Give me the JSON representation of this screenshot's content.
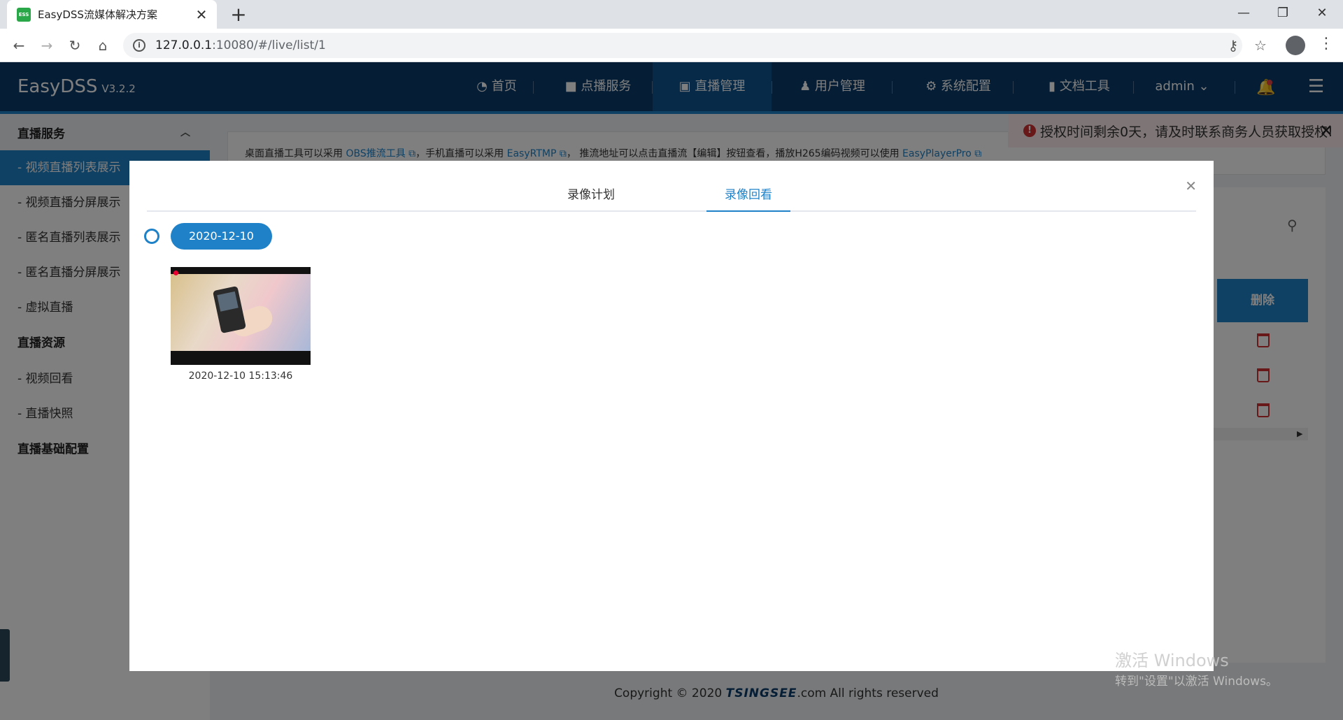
{
  "browser": {
    "tab_title": "EasyDSS流媒体解决方案",
    "favicon_text": "ESS",
    "url_host": "127.0.0.1",
    "url_rest": ":10080/#/live/list/1"
  },
  "app": {
    "brand": "EasyDSS",
    "version": "V3.2.2",
    "nav": [
      {
        "label": "首页",
        "icon": "dashboard-icon"
      },
      {
        "label": "点播服务",
        "icon": "video-camera-icon"
      },
      {
        "label": "直播管理",
        "icon": "live-camera-icon"
      },
      {
        "label": "用户管理",
        "icon": "user-icon"
      },
      {
        "label": "系统配置",
        "icon": "gear-icon"
      },
      {
        "label": "文档工具",
        "icon": "book-icon"
      }
    ],
    "user": "admin"
  },
  "sidebar": {
    "group1": "直播服务",
    "items1": [
      "- 视频直播列表展示",
      "- 视频直播分屏展示",
      "- 匿名直播列表展示",
      "- 匿名直播分屏展示",
      "- 虚拟直播"
    ],
    "group2": "直播资源",
    "items2": [
      "- 视频回看",
      "- 直播快照"
    ],
    "group3": "直播基础配置"
  },
  "notice": {
    "t1": "桌面直播工具可以采用 ",
    "link1": "OBS推流工具",
    "t2": "，手机直播可以采用 ",
    "link2": "EasyRTMP",
    "t3": "， 推流地址可以点击直播流【编辑】按钮查看，播放H265编码视频可以使用 ",
    "link3": "EasyPlayerPro"
  },
  "alert": "授权时间剩余0天，请及时联系商务人员获取授权!",
  "table": {
    "delete_header": "删除"
  },
  "modal": {
    "tabs": [
      "录像计划",
      "录像回看"
    ],
    "active_tab": 1,
    "date": "2020-12-10",
    "recordings": [
      {
        "time": "2020-12-10 15:13:46"
      }
    ]
  },
  "footer": {
    "pre": "Copyright © 2020 ",
    "brand": "TSINGSEE",
    "post": ".com All rights reserved"
  },
  "watermark": {
    "line1": "激活 Windows",
    "line2": "转到\"设置\"以激活 Windows。"
  },
  "colors": {
    "header_bg": "#0a3d6d",
    "accent": "#1f82c8",
    "alert_bg": "#fdecec",
    "danger": "#d03030"
  }
}
